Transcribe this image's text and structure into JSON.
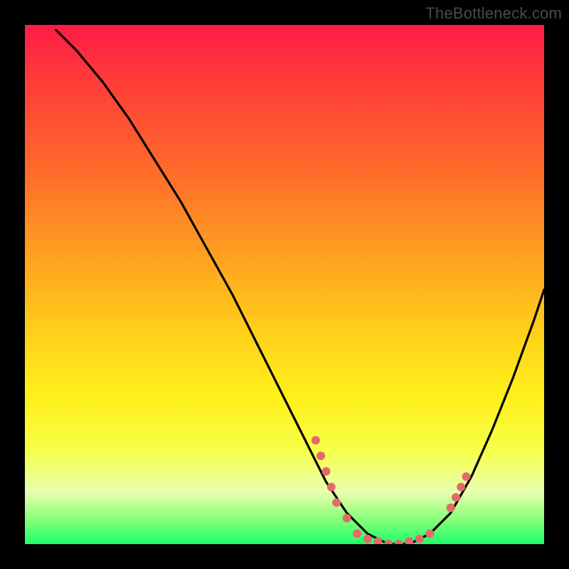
{
  "watermark": "TheBottleneck.com",
  "colors": {
    "frame_bg": "#000000",
    "gradient_top": "#ff1a46",
    "gradient_mid1": "#ffa21f",
    "gradient_mid2": "#fff01a",
    "gradient_bottom": "#1dff6a",
    "curve": "#000000",
    "dot": "#e36a6a"
  },
  "chart_data": {
    "type": "line",
    "title": "",
    "xlabel": "",
    "ylabel": "",
    "xlim": [
      0,
      100
    ],
    "ylim": [
      0,
      100
    ],
    "series": [
      {
        "name": "curve",
        "x": [
          6,
          10,
          15,
          20,
          25,
          30,
          35,
          40,
          45,
          50,
          55,
          58,
          62,
          66,
          70,
          74,
          78,
          82,
          86,
          90,
          94,
          98,
          100
        ],
        "y": [
          99,
          95,
          89,
          82,
          74,
          66,
          57,
          48,
          38,
          28,
          18,
          12,
          6,
          2,
          0,
          0,
          2,
          6,
          13,
          22,
          32,
          43,
          49
        ]
      }
    ],
    "points": [
      {
        "x": 56,
        "y": 20
      },
      {
        "x": 57,
        "y": 17
      },
      {
        "x": 58,
        "y": 14
      },
      {
        "x": 59,
        "y": 11
      },
      {
        "x": 60,
        "y": 8
      },
      {
        "x": 62,
        "y": 5
      },
      {
        "x": 64,
        "y": 2
      },
      {
        "x": 66,
        "y": 1
      },
      {
        "x": 68,
        "y": 0.5
      },
      {
        "x": 70,
        "y": 0
      },
      {
        "x": 72,
        "y": 0
      },
      {
        "x": 74,
        "y": 0.5
      },
      {
        "x": 76,
        "y": 1
      },
      {
        "x": 78,
        "y": 2
      },
      {
        "x": 82,
        "y": 7
      },
      {
        "x": 83,
        "y": 9
      },
      {
        "x": 84,
        "y": 11
      },
      {
        "x": 85,
        "y": 13
      }
    ]
  }
}
